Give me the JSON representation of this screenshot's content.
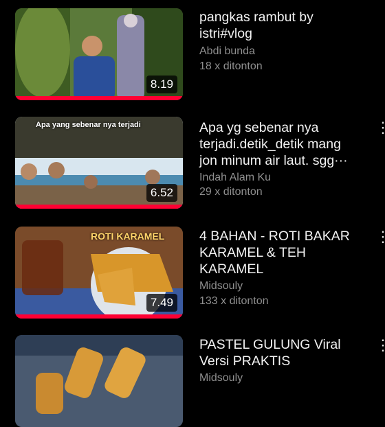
{
  "videos": [
    {
      "title": "pangkas rambut by\nistri#vlog",
      "channel": "Abdi bunda",
      "views": "18 x ditonton",
      "duration": "8.19",
      "progress": 1.0,
      "overlay_text": ""
    },
    {
      "title": "Apa yg sebenar nya\nterjadi.detik_detik mang\njon minum air laut. sgg···",
      "channel": "Indah Alam Ku",
      "views": "29 x ditonton",
      "duration": "6.52",
      "progress": 1.0,
      "overlay_text": "Apa yang sebenar nya terjadi"
    },
    {
      "title": "4 BAHAN - ROTI BAKAR\nKARAMEL & TEH\nKARAMEL",
      "channel": "Midsouly",
      "views": "133 x ditonton",
      "duration": "7.49",
      "progress": 1.0,
      "overlay_text": "ROTI KARAMEL"
    },
    {
      "title": "PASTEL GULUNG Viral\nVersi PRAKTIS",
      "channel": "Midsouly",
      "views": "",
      "duration": "",
      "progress": 0,
      "overlay_text": ""
    }
  ],
  "menu_icon": "more-vertical-icon",
  "colors": {
    "progress": "#ff0033",
    "meta": "#8f8f8f"
  }
}
